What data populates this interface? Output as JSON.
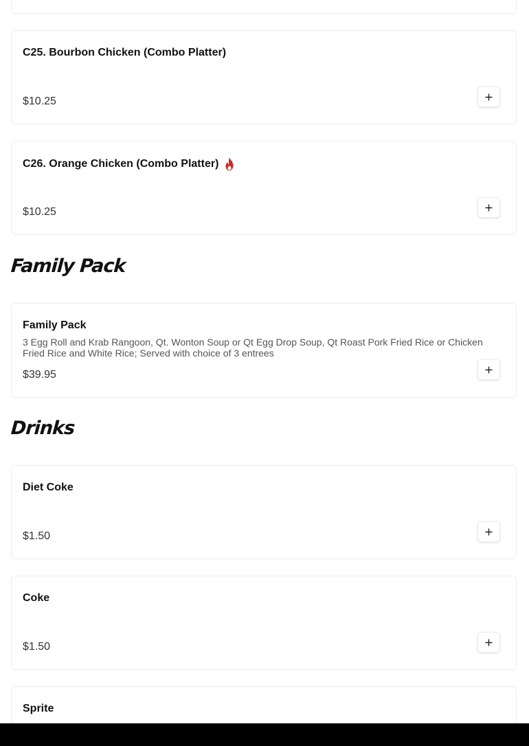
{
  "items": {
    "c25": {
      "title": "C25. Bourbon Chicken (Combo Platter)",
      "price": "$10.25"
    },
    "c26": {
      "title": "C26. Orange Chicken (Combo Platter)",
      "price": "$10.25",
      "spicy_icon": "fire-icon"
    },
    "family_pack": {
      "title": "Family Pack",
      "description": "3 Egg Roll and Krab Rangoon, Qt. Wonton Soup or Qt Egg Drop Soup, Qt Roast Pork Fried Rice or Chicken Fried Rice and White Rice; Served with choice of 3 entrees",
      "price": "$39.95"
    },
    "diet_coke": {
      "title": "Diet Coke",
      "price": "$1.50"
    },
    "coke": {
      "title": "Coke",
      "price": "$1.50"
    },
    "sprite": {
      "title": "Sprite"
    }
  },
  "sections": {
    "family_pack": "Family Pack",
    "drinks": "Drinks"
  },
  "icons": {
    "add": "plus-icon",
    "spicy": "fire-icon"
  },
  "colors": {
    "spicy": "#c62828",
    "card_border": "#ececec",
    "price_text": "#333333",
    "bottom_bar": "#000000"
  }
}
